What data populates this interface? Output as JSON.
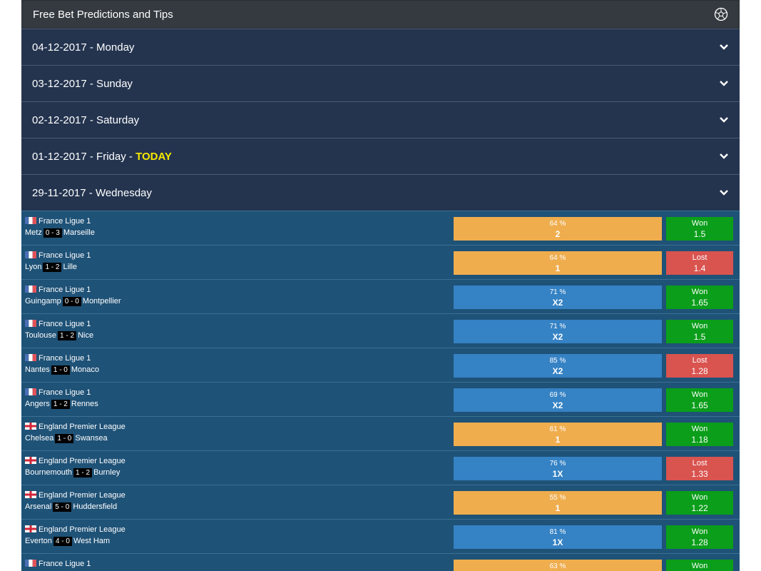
{
  "header": {
    "title": "Free Bet Predictions and Tips",
    "icon": "soccer-ball-icon"
  },
  "days": [
    {
      "label": "04-12-2017 - Monday",
      "today": ""
    },
    {
      "label": "03-12-2017 - Sunday",
      "today": ""
    },
    {
      "label": "02-12-2017 - Saturday",
      "today": ""
    },
    {
      "label": "01-12-2017 - Friday - ",
      "today": "TODAY"
    },
    {
      "label": "29-11-2017 - Wednesday",
      "today": ""
    }
  ],
  "colors": {
    "orange": "#efad4e",
    "blue": "#3582c4",
    "won": "#0a9e1a",
    "lost": "#d9534f",
    "today": "#f5e800"
  },
  "matches": [
    {
      "league": "France Ligue 1",
      "flag": "france",
      "home": "Metz",
      "score": "0 - 3",
      "away": "Marseille",
      "pct": "64 %",
      "tip": "2",
      "color": "orange",
      "result": "Won",
      "odds": "1.5"
    },
    {
      "league": "France Ligue 1",
      "flag": "france",
      "home": "Lyon",
      "score": "1 - 2",
      "away": "Lille",
      "pct": "64 %",
      "tip": "1",
      "color": "orange",
      "result": "Lost",
      "odds": "1.4"
    },
    {
      "league": "France Ligue 1",
      "flag": "france",
      "home": "Guingamp",
      "score": "0 - 0",
      "away": "Montpellier",
      "pct": "71 %",
      "tip": "X2",
      "color": "blue",
      "result": "Won",
      "odds": "1.65"
    },
    {
      "league": "France Ligue 1",
      "flag": "france",
      "home": "Toulouse",
      "score": "1 - 2",
      "away": "Nice",
      "pct": "71 %",
      "tip": "X2",
      "color": "blue",
      "result": "Won",
      "odds": "1.5"
    },
    {
      "league": "France Ligue 1",
      "flag": "france",
      "home": "Nantes",
      "score": "1 - 0",
      "away": "Monaco",
      "pct": "85 %",
      "tip": "X2",
      "color": "blue",
      "result": "Lost",
      "odds": "1.28"
    },
    {
      "league": "France Ligue 1",
      "flag": "france",
      "home": "Angers",
      "score": "1 - 2",
      "away": "Rennes",
      "pct": "69 %",
      "tip": "X2",
      "color": "blue",
      "result": "Won",
      "odds": "1.65"
    },
    {
      "league": "England Premier League",
      "flag": "england",
      "home": "Chelsea",
      "score": "1 - 0",
      "away": "Swansea",
      "pct": "61 %",
      "tip": "1",
      "color": "orange",
      "result": "Won",
      "odds": "1.18"
    },
    {
      "league": "England Premier League",
      "flag": "england",
      "home": "Bournemouth",
      "score": "1 - 2",
      "away": "Burnley",
      "pct": "76 %",
      "tip": "1X",
      "color": "blue",
      "result": "Lost",
      "odds": "1.33"
    },
    {
      "league": "England Premier League",
      "flag": "england",
      "home": "Arsenal",
      "score": "5 - 0",
      "away": "Huddersfield",
      "pct": "55 %",
      "tip": "1",
      "color": "orange",
      "result": "Won",
      "odds": "1.22"
    },
    {
      "league": "England Premier League",
      "flag": "england",
      "home": "Everton",
      "score": "4 - 0",
      "away": "West Ham",
      "pct": "81 %",
      "tip": "1X",
      "color": "blue",
      "result": "Won",
      "odds": "1.28"
    },
    {
      "league": "France Ligue 1",
      "flag": "france",
      "home": "",
      "score": "",
      "away": "",
      "pct": "63 %",
      "tip": "",
      "color": "orange",
      "result": "Won",
      "odds": ""
    }
  ]
}
